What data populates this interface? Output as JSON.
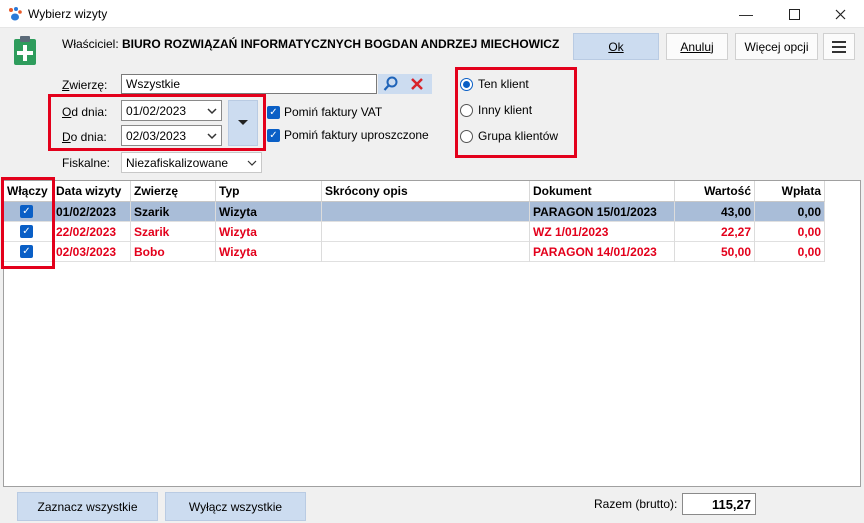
{
  "window": {
    "title": "Wybierz wizyty"
  },
  "owner": {
    "label": "Właściciel:",
    "value": "BIURO ROZWIĄZAŃ INFORMATYCZNYCH BOGDAN ANDRZEJ MIECHOWICZ"
  },
  "buttons": {
    "ok": "Ok",
    "cancel": "Anuluj",
    "more": "Więcej opcji",
    "select_all": "Zaznacz wszystkie",
    "deselect_all": "Wyłącz wszystkie"
  },
  "filters": {
    "animal_label": "Zwierzę:",
    "animal_value": "Wszystkie",
    "from_label": "Od dnia:",
    "from_value": "01/02/2023",
    "to_label": "Do dnia:",
    "to_value": "02/03/2023",
    "fiscal_label": "Fiskalne:",
    "fiscal_value": "Niezafiskalizowane",
    "skip_vat": "Pomiń faktury VAT",
    "skip_simple": "Pomiń faktury uproszczone"
  },
  "client_options": [
    "Ten klient",
    "Inny klient",
    "Grupa klientów"
  ],
  "table": {
    "headers": [
      "Włączy",
      "Data wizyty",
      "Zwierzę",
      "Typ",
      "Skrócony opis",
      "Dokument",
      "Wartość",
      "Wpłata"
    ],
    "rows": [
      {
        "date": "01/02/2023",
        "animal": "Szarik",
        "type": "Wizyta",
        "desc": "",
        "doc": "PARAGON 15/01/2023",
        "value": "43,00",
        "paid": "0,00"
      },
      {
        "date": "22/02/2023",
        "animal": "Szarik",
        "type": "Wizyta",
        "desc": "",
        "doc": "WZ 1/01/2023",
        "value": "22,27",
        "paid": "0,00"
      },
      {
        "date": "02/03/2023",
        "animal": "Bobo",
        "type": "Wizyta",
        "desc": "",
        "doc": "PARAGON 14/01/2023",
        "value": "50,00",
        "paid": "0,00"
      }
    ]
  },
  "summary": {
    "label": "Razem (brutto):",
    "value": "115,27"
  },
  "colors": {
    "accent": "#0a5fc6",
    "highlight": "#e3001b",
    "selected_row": "#a9bdd8",
    "button": "#ccdcf0"
  }
}
